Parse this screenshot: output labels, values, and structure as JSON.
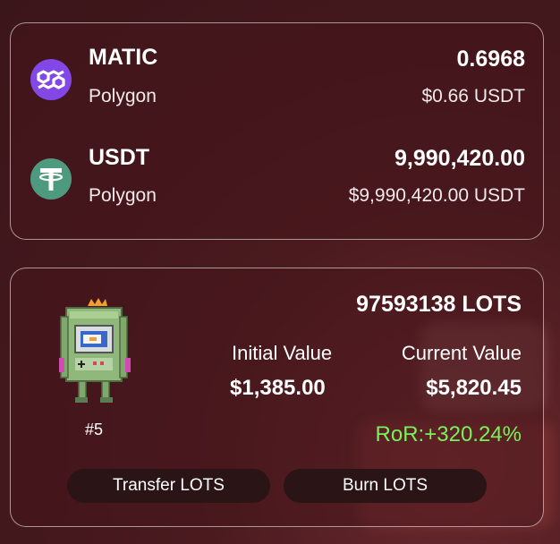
{
  "colors": {
    "matic": "#8247e5",
    "usdt": "#4e9a7e",
    "ror_positive": "#77f25a",
    "button_bg": "#2a1416"
  },
  "assets": [
    {
      "symbol": "MATIC",
      "network": "Polygon",
      "amount": "0.6968",
      "value": "$0.66 USDT",
      "icon": "polygon-icon"
    },
    {
      "symbol": "USDT",
      "network": "Polygon",
      "amount": "9,990,420.00",
      "value": "$9,990,420.00 USDT",
      "icon": "tether-icon"
    }
  ],
  "nft": {
    "id_label": "#5",
    "amount": "97593138 LOTS",
    "initial_value_label": "Initial Value",
    "initial_value": "$1,385.00",
    "current_value_label": "Current Value",
    "current_value": "$5,820.45",
    "ror": "RoR:+320.24%",
    "art_icon": "arcade-robot-icon"
  },
  "buttons": {
    "transfer_label": "Transfer LOTS",
    "burn_label": "Burn LOTS"
  }
}
